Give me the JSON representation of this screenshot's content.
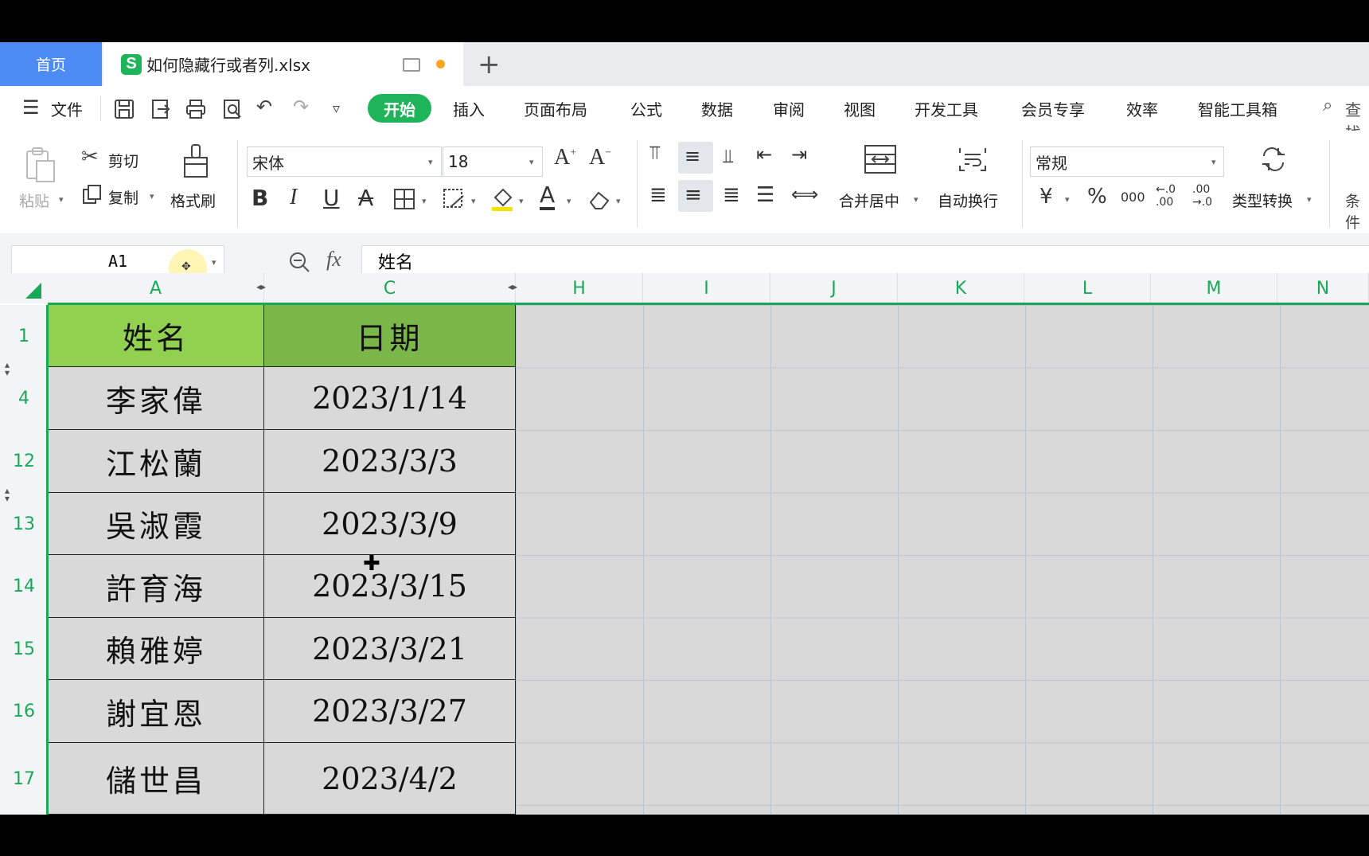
{
  "tabs": {
    "home_label": "首页",
    "file_title": "如何隐藏行或者列.xlsx",
    "new_tab": "+"
  },
  "menu": {
    "file_label": "文件",
    "items": [
      "开始",
      "插入",
      "页面布局",
      "公式",
      "数据",
      "审阅",
      "视图",
      "开发工具",
      "会员专享",
      "效率",
      "智能工具箱"
    ],
    "search_label": "查找"
  },
  "ribbon": {
    "paste": "粘贴",
    "cut": "剪切",
    "copy": "复制",
    "format_painter": "格式刷",
    "font_name": "宋体",
    "font_size": "18",
    "merge_center": "合并居中",
    "wrap_text": "自动换行",
    "number_format": "常规",
    "type_convert": "类型转换",
    "conditional": "条件",
    "currency_symbol": "¥",
    "percent_symbol": "%",
    "thousands_symbol": "000",
    "inc_decimal": "←.0 .00",
    "dec_decimal": ".00 →.0"
  },
  "formula_bar": {
    "cell_ref": "A1",
    "fx": "fx",
    "value": "姓名"
  },
  "columns": [
    "A",
    "C",
    "H",
    "I",
    "J",
    "K",
    "L",
    "M",
    "N"
  ],
  "rows": [
    "1",
    "4",
    "12",
    "13",
    "14",
    "15",
    "16",
    "17"
  ],
  "table": {
    "header": [
      "姓名",
      "日期"
    ],
    "rows": [
      [
        "李家偉",
        "2023/1/14"
      ],
      [
        "江松蘭",
        "2023/3/3"
      ],
      [
        "吳淑霞",
        "2023/3/9"
      ],
      [
        "許育海",
        "2023/3/15"
      ],
      [
        "賴雅婷",
        "2023/3/21"
      ],
      [
        "謝宜恩",
        "2023/3/27"
      ],
      [
        "儲世昌",
        "2023/4/2"
      ]
    ]
  },
  "colors": {
    "accent_green": "#1fb35a",
    "header_a": "#92d050",
    "header_c": "#7ab648",
    "home_tab": "#4d8bf5"
  }
}
